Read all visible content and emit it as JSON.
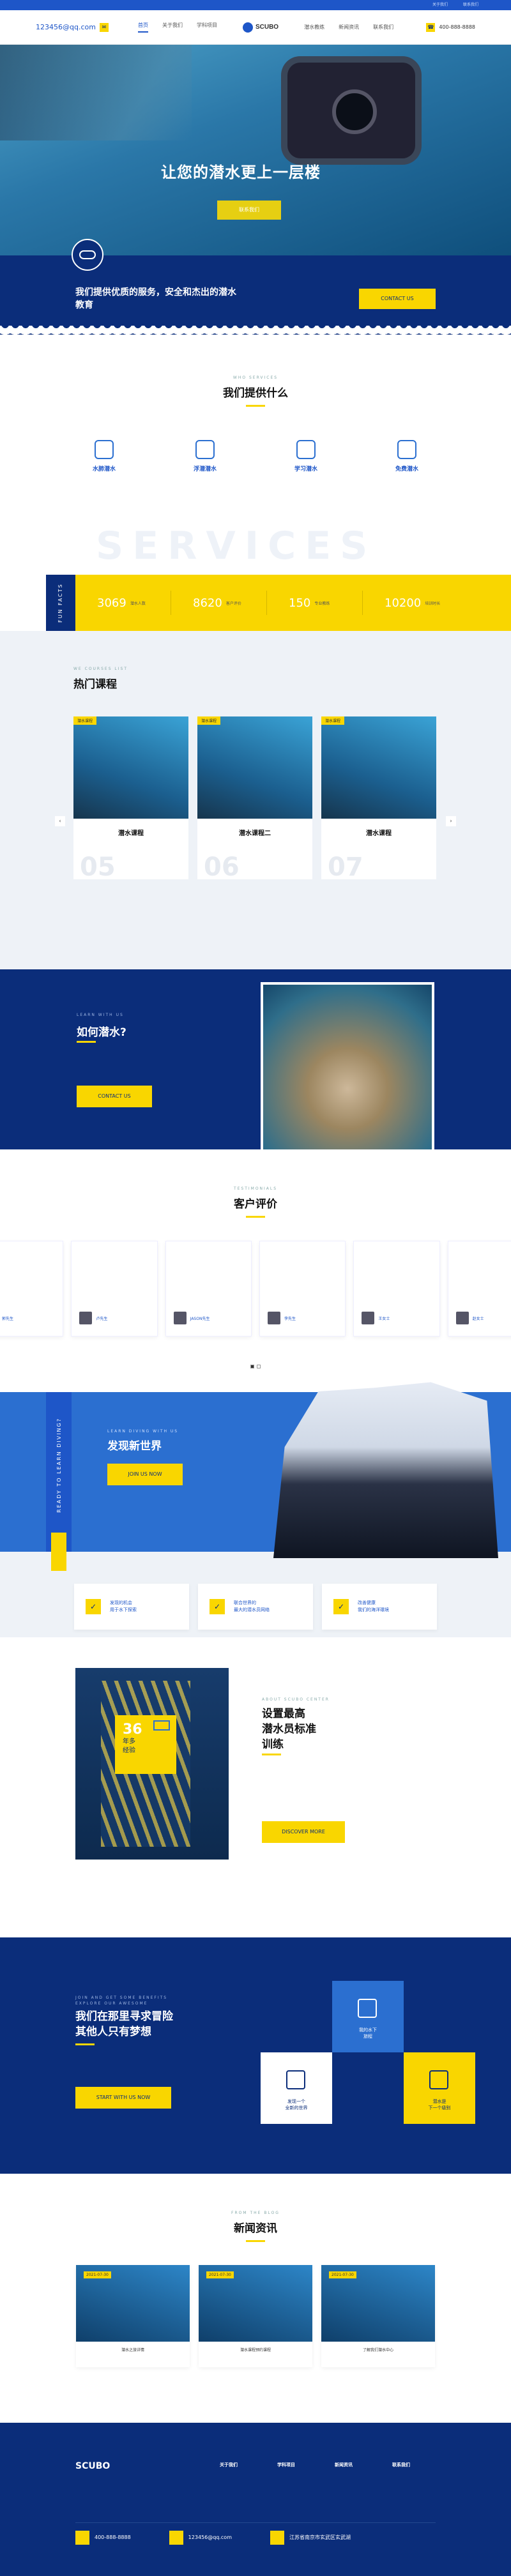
{
  "topbar": {
    "left": "",
    "right": [
      "关于我们",
      "联系我们"
    ]
  },
  "header": {
    "email": "123456@qq.com",
    "nav": [
      "首页",
      "关于我们",
      "学科项目",
      "潜水教练",
      "新闻资讯",
      "联系我们"
    ],
    "brand": "SCUBO",
    "phone": "400-888-8888"
  },
  "hero": {
    "title": "让您的潜水更上一层楼",
    "btn": "联系我们"
  },
  "band": {
    "text": "我们提供优质的服务，安全和杰出的潜水教育",
    "btn": "CONTACT US"
  },
  "services": {
    "small": "WHO SERVICES",
    "title": "我们提供什么",
    "watermark": "SERVICES",
    "items": [
      {
        "name": "水肺潜水",
        "desc": ""
      },
      {
        "name": "浮潜潜水",
        "desc": ""
      },
      {
        "name": "学习潜水",
        "desc": ""
      },
      {
        "name": "免费潜水",
        "desc": ""
      }
    ]
  },
  "facts": {
    "label": "FUN FACTS",
    "items": [
      {
        "n": "3069",
        "l": "潜水人数"
      },
      {
        "n": "8620",
        "l": "客户评价"
      },
      {
        "n": "150",
        "l": "专业教练"
      },
      {
        "n": "10200",
        "l": "培训时长"
      }
    ]
  },
  "courses": {
    "small": "WE COURSES LIST",
    "title": "热门课程",
    "desc": "",
    "items": [
      {
        "tag": "潜水课程",
        "t": "潜水课程",
        "d": "",
        "n": "05"
      },
      {
        "tag": "潜水课程",
        "t": "潜水课程二",
        "d": "",
        "n": "06"
      },
      {
        "tag": "潜水课程",
        "t": "潜水课程",
        "d": "",
        "n": "07"
      }
    ]
  },
  "why": {
    "small": "LEARN WITH US",
    "title": "如何潜水?",
    "desc": "",
    "btn": "CONTACT US"
  },
  "reviews": {
    "small": "TESTIMONIALS",
    "title": "客户评价",
    "items": [
      {
        "p": "",
        "n": "郭先生"
      },
      {
        "p": "",
        "n": "卢先生"
      },
      {
        "p": "",
        "n": "JASON先生"
      },
      {
        "p": "",
        "n": "李先生"
      },
      {
        "p": "",
        "n": "王女士"
      },
      {
        "p": "",
        "n": "赵女士"
      }
    ]
  },
  "discover": {
    "vlabel": "READY TO LEARN DIVING?",
    "small": "LEARN DIVING WITH US",
    "title": "发现新世界",
    "btn": "JOIN US NOW"
  },
  "features": [
    "发现的机会\n用于水下探索",
    "联合世界的\n最大的潜水员网络",
    "改善健康\n我们的海洋環境"
  ],
  "standard": {
    "num": "36",
    "unit": "年多\n经验",
    "small": "ABOUT SCUBO CENTER",
    "title": "设置最高\n潜水员标准\n训练",
    "desc": "",
    "btn": "DISCOVER MORE"
  },
  "dreams": {
    "small": "JOIN AND GET SOME BENEFITS\nEXPLORE OUR AWESOME",
    "title": "我们在那里寻求冒险\n其他人只有梦想",
    "desc": "",
    "btn": "START WITH US NOW",
    "tiles": [
      "我的水下\n旅程",
      "发现一个\n全新的世界",
      "潜水是\n下一个级别"
    ]
  },
  "news": {
    "small": "FROM THE BLOG",
    "title": "新闻资讯",
    "items": [
      {
        "d": "2021-07-30",
        "t": "潜水之旅详情",
        "s": ""
      },
      {
        "d": "2021-07-30",
        "t": "潜水课程预约课程",
        "s": ""
      },
      {
        "d": "2021-07-30",
        "t": "了解我们潜水中心",
        "s": ""
      }
    ]
  },
  "footer": {
    "brand": "SCUBO",
    "copy": "",
    "cols": [
      {
        "h": "关于我们",
        "l": []
      },
      {
        "h": "学科项目",
        "l": []
      },
      {
        "h": "新闻资讯",
        "l": []
      },
      {
        "h": "联系我们",
        "l": []
      }
    ],
    "phone": "400-888-8888",
    "email": "123456@qq.com",
    "addr": "江苏省南京市玄武区玄武湖"
  }
}
